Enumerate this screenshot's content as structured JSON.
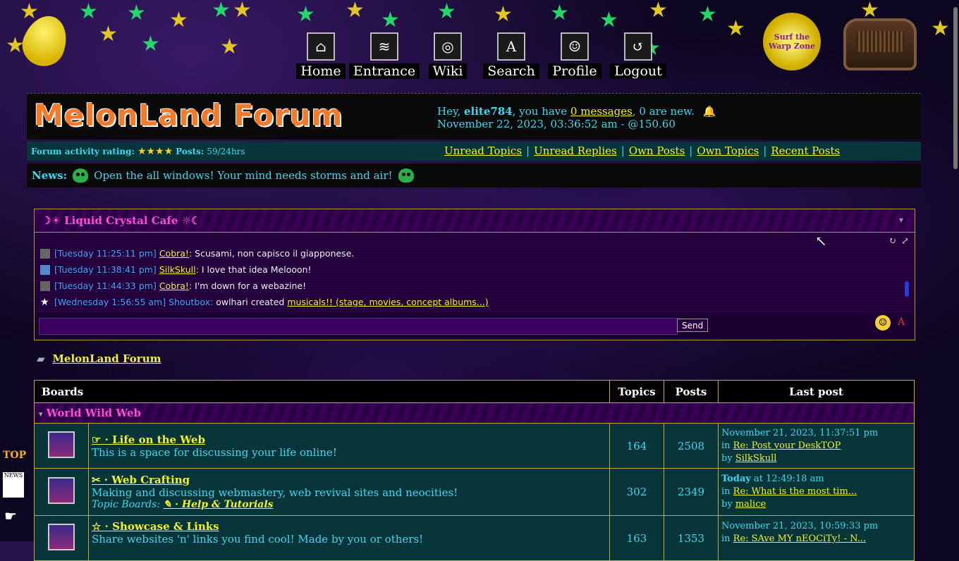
{
  "nav": [
    {
      "label": "Home",
      "icon": "house-icon",
      "glyph": "⌂"
    },
    {
      "label": "Entrance",
      "icon": "cat-icon",
      "glyph": "≋"
    },
    {
      "label": "Wiki",
      "icon": "globe-icon",
      "glyph": "◎"
    },
    {
      "label": "Search",
      "icon": "abc-blocks-icon",
      "glyph": "A"
    },
    {
      "label": "Profile",
      "icon": "avatar-icon",
      "glyph": "☺"
    },
    {
      "label": "Logout",
      "icon": "exit-icon",
      "glyph": "↺"
    }
  ],
  "badge_text": "Surf the Warp Zone",
  "logo": "MelonLand Forum",
  "user": {
    "greeting_prefix": "Hey, ",
    "name": "elite784",
    "mid_text": ", you have ",
    "messages_link": "0 messages",
    "suffix": ", 0 are new.",
    "datetime": "November 22, 2023, 03:36:52 am - @150.60"
  },
  "activity": {
    "rating_label": "Forum activity rating:",
    "stars": "★★★★",
    "posts_label": "Posts:",
    "posts_value": "59/24hrs"
  },
  "quick_links": [
    "Unread Topics",
    "Unread Replies",
    "Own Posts",
    "Own Topics",
    "Recent Posts"
  ],
  "news": {
    "label": "News:",
    "text": "Open the all windows! Your mind needs storms and air!"
  },
  "shoutbox": {
    "title": "☽☀ Liquid Crystal Cafe ☼☾",
    "messages": [
      {
        "time": "[Tuesday 11:25:11 pm]",
        "user": "Cobra!",
        "msg": "Scusami, non capisco il giapponese.",
        "link": ""
      },
      {
        "time": "[Tuesday 11:38:41 pm]",
        "user": "SilkSkull",
        "msg": "I love that idea Melooon!",
        "link": ""
      },
      {
        "time": "[Tuesday 11:44:33 pm]",
        "user": "Cobra!",
        "msg": "I'm down for a webazine!",
        "link": ""
      },
      {
        "time": "[Wednesday 1:56:55 am] Shoutbox:",
        "user": "",
        "msg": "owlhari created",
        "link": "musicals!! (stage, movies, concept albums...)"
      }
    ],
    "send_label": "Send"
  },
  "breadcrumb": "MelonLand Forum",
  "table": {
    "headers": {
      "boards": "Boards",
      "topics": "Topics",
      "posts": "Posts",
      "last": "Last post"
    },
    "category": "World Wild Web",
    "rows": [
      {
        "name": "☞ · Life on the Web",
        "desc": "This is a space for discussing your life online!",
        "topic_boards": "",
        "topic_board_link": "",
        "topics": "164",
        "posts": "2508",
        "last_date": "November 21, 2023, 11:37:51 pm",
        "last_date_bold": "",
        "in_label": "in ",
        "last_topic": "Re: Post your DeskTOP",
        "by_label": "by ",
        "last_user": "SilkSkull"
      },
      {
        "name": "✂ · Web Crafting",
        "desc": "Making and discussing webmastery, web revival sites and neocities!",
        "topic_boards": "Topic Boards: ",
        "topic_board_link": "✎ · Help & Tutorials",
        "topics": "302",
        "posts": "2349",
        "last_date": " at 12:49:18 am",
        "last_date_bold": "Today",
        "in_label": "in ",
        "last_topic": "Re: What is the most tim...",
        "by_label": "by ",
        "last_user": "malice"
      },
      {
        "name": "☆ · Showcase & Links",
        "desc": "Share websites 'n' links you find cool! Made by you or others!",
        "topic_boards": "",
        "topic_board_link": "",
        "topics": "163",
        "posts": "1353",
        "last_date": "November 21, 2023, 10:59:33 pm",
        "last_date_bold": "",
        "in_label": "in ",
        "last_topic": "Re: SAve MY nEOCiTy! - N...",
        "by_label": "",
        "last_user": ""
      }
    ]
  },
  "side": {
    "top": "TOP",
    "news": "NEWS"
  }
}
